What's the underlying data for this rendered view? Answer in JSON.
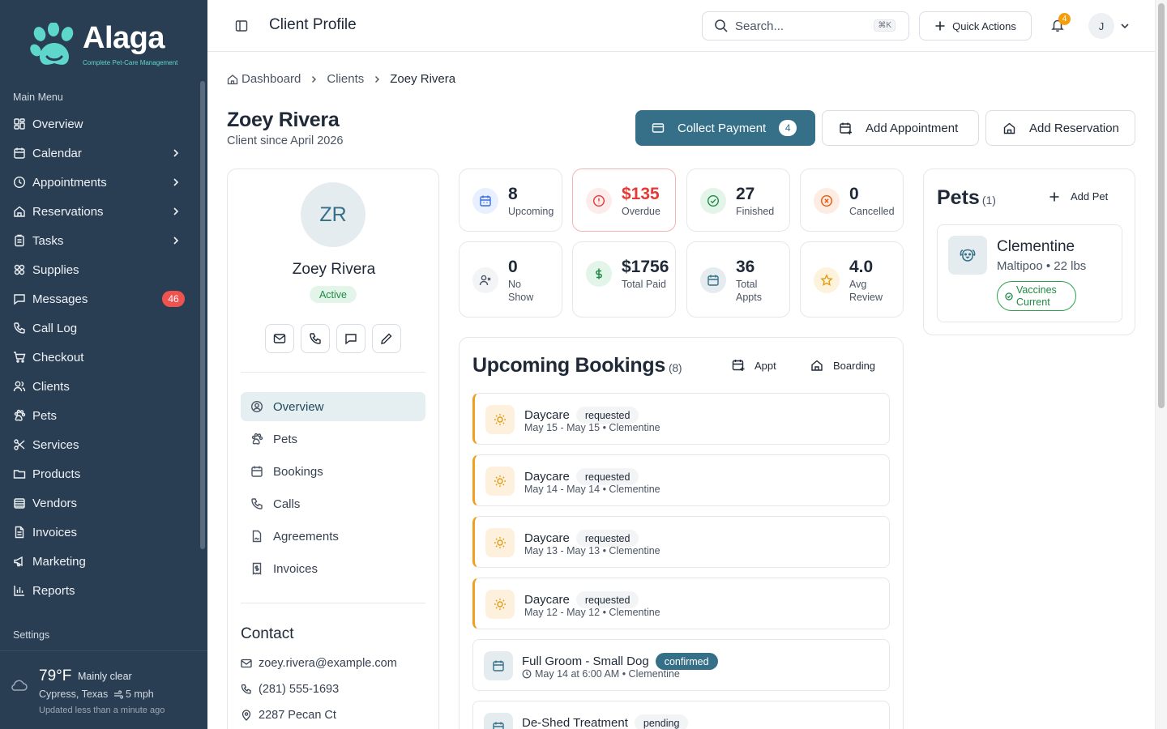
{
  "sidebar": {
    "brand": "Alaga",
    "tagline": "Complete Pet-Care Management",
    "main_menu_label": "Main Menu",
    "settings_label": "Settings",
    "items": [
      {
        "label": "Overview",
        "icon": "dashboard-icon"
      },
      {
        "label": "Calendar",
        "icon": "calendar-icon",
        "has_submenu": true
      },
      {
        "label": "Appointments",
        "icon": "clock-icon",
        "has_submenu": true
      },
      {
        "label": "Reservations",
        "icon": "home-icon",
        "has_submenu": true
      },
      {
        "label": "Tasks",
        "icon": "clipboard-icon",
        "has_submenu": true
      },
      {
        "label": "Supplies",
        "icon": "boxes-icon"
      },
      {
        "label": "Messages",
        "icon": "message-icon",
        "badge": "46"
      },
      {
        "label": "Call Log",
        "icon": "phone-icon"
      },
      {
        "label": "Checkout",
        "icon": "cart-icon"
      },
      {
        "label": "Clients",
        "icon": "users-icon"
      },
      {
        "label": "Pets",
        "icon": "paw-icon"
      },
      {
        "label": "Services",
        "icon": "scissors-icon"
      },
      {
        "label": "Products",
        "icon": "package-icon"
      },
      {
        "label": "Vendors",
        "icon": "store-icon"
      },
      {
        "label": "Invoices",
        "icon": "file-text-icon"
      },
      {
        "label": "Marketing",
        "icon": "megaphone-icon"
      },
      {
        "label": "Reports",
        "icon": "bar-chart-icon"
      }
    ],
    "weather": {
      "temp": "79°F",
      "condition": "Mainly clear",
      "location": "Cypress, Texas",
      "wind": "5 mph",
      "updated": "Updated less than a minute ago"
    }
  },
  "header": {
    "title": "Client Profile",
    "search_placeholder": "Search...",
    "search_shortcut": "⌘K",
    "quick_actions": "Quick Actions",
    "notification_count": "4",
    "user_initial": "J"
  },
  "breadcrumb": {
    "home": "Dashboard",
    "parent": "Clients",
    "current": "Zoey Rivera"
  },
  "client": {
    "name": "Zoey Rivera",
    "since": "Client since April 2026",
    "initials": "ZR",
    "status": "Active"
  },
  "actions": {
    "collect_payment": "Collect Payment",
    "collect_payment_count": "4",
    "add_appointment": "Add Appointment",
    "add_reservation": "Add Reservation"
  },
  "profile_nav": [
    {
      "label": "Overview",
      "icon": "user-circle-icon",
      "active": true
    },
    {
      "label": "Pets",
      "icon": "paw-icon"
    },
    {
      "label": "Bookings",
      "icon": "calendar-icon"
    },
    {
      "label": "Calls",
      "icon": "phone-icon"
    },
    {
      "label": "Agreements",
      "icon": "signature-icon"
    },
    {
      "label": "Invoices",
      "icon": "receipt-icon"
    }
  ],
  "contact": {
    "title": "Contact",
    "email": "zoey.rivera@example.com",
    "phone": "(281) 555-1693",
    "address": "2287 Pecan Ct"
  },
  "stats": [
    {
      "value": "8",
      "label": "Upcoming",
      "icon": "calendar-icon",
      "color": "#3b6fd8",
      "bg": "#e8efff"
    },
    {
      "value": "$135",
      "label": "Overdue",
      "icon": "alert-circle-icon",
      "color": "#e53935",
      "bg": "#fdecec",
      "alert": true
    },
    {
      "value": "27",
      "label": "Finished",
      "icon": "check-circle-icon",
      "color": "#1f8a45",
      "bg": "#e3f5e8"
    },
    {
      "value": "0",
      "label": "Cancelled",
      "icon": "x-circle-icon",
      "color": "#ea580c",
      "bg": "#fdece2"
    },
    {
      "value": "0",
      "label": "No Show",
      "icon": "user-x-icon",
      "color": "#4b5563",
      "bg": "#f2f4f6"
    },
    {
      "value": "$1756",
      "label": "Total Paid",
      "icon": "dollar-icon",
      "color": "#1f8a45",
      "bg": "#e3f5e8"
    },
    {
      "value": "36",
      "label": "Total Appts",
      "icon": "calendar-icon",
      "color": "#357088",
      "bg": "#e5ecef"
    },
    {
      "value": "4.0",
      "label": "Avg Review",
      "icon": "star-icon",
      "color": "#e39b12",
      "bg": "#fdf3dc"
    }
  ],
  "bookings": {
    "title": "Upcoming Bookings",
    "count": "(8)",
    "appt_button": "Appt",
    "boarding_button": "Boarding",
    "items": [
      {
        "name": "Daycare",
        "status": "requested",
        "sub": "May 15 - May 15 • Clementine",
        "icon": "sun-icon"
      },
      {
        "name": "Daycare",
        "status": "requested",
        "sub": "May 14 - May 14 • Clementine",
        "icon": "sun-icon"
      },
      {
        "name": "Daycare",
        "status": "requested",
        "sub": "May 13 - May 13 • Clementine",
        "icon": "sun-icon"
      },
      {
        "name": "Daycare",
        "status": "requested",
        "sub": "May 12 - May 12 • Clementine",
        "icon": "sun-icon"
      },
      {
        "name": "Full Groom - Small Dog",
        "status": "confirmed",
        "sub": "May 14 at 6:00 AM • Clementine",
        "icon": "calendar-icon"
      },
      {
        "name": "De-Shed Treatment",
        "status": "pending",
        "sub": "",
        "icon": "calendar-icon"
      }
    ]
  },
  "pets": {
    "title": "Pets",
    "count": "(1)",
    "add_label": "Add Pet",
    "items": [
      {
        "name": "Clementine",
        "breed": "Maltipoo • 22 lbs",
        "vaccine_status": "Vaccines Current",
        "icon": "dog-icon"
      }
    ]
  },
  "colors": {
    "sidebar_bg": "#2a3e53",
    "primary": "#357088",
    "accent_teal": "#5ed6cc",
    "badge_red": "#ef5350",
    "requested_border": "#f0a020"
  }
}
